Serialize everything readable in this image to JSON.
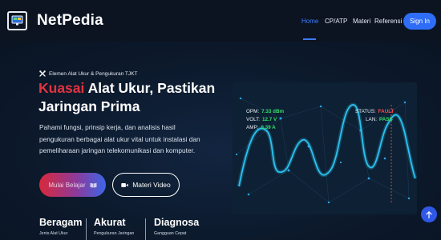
{
  "brand": {
    "name": "NetPedia",
    "icon": "monitor-icon"
  },
  "nav": {
    "items": [
      {
        "label": "Home",
        "active": true
      },
      {
        "label": "CP/ATP",
        "active": false
      },
      {
        "label": "Materi",
        "active": false
      },
      {
        "label": "Referensi",
        "active": false
      }
    ],
    "signin_label": "Sign In"
  },
  "hero": {
    "eyebrow": "Elemen Alat Ukur & Pengukuran TJKT",
    "eyebrow_icon": "tools-icon",
    "headline_accent": "Kuasai",
    "headline_rest": " Alat Ukur, Pastikan Jaringan Prima",
    "description": "Pahami fungsi, prinsip kerja, dan analisis hasil pengukuran berbagai alat ukur vital untuk instalasi dan pemeliharaan jaringan telekomunikasi dan komputer.",
    "primary_button": "Mulai Belajar",
    "primary_button_icon": "book-icon",
    "secondary_button": "Materi Video",
    "secondary_button_icon": "video-camera-icon"
  },
  "stats": [
    {
      "value": "Beragam",
      "label": "Jenis Alat Ukur"
    },
    {
      "value": "Akurat",
      "label": "Pengukuran Jaringan"
    },
    {
      "value": "Diagnosa",
      "label": "Gangguan Cepat"
    }
  ],
  "scope": {
    "readings": [
      {
        "key": "OPM:",
        "value": "7.33 dBm"
      },
      {
        "key": "VOLT:",
        "value": "12.7 V"
      },
      {
        "key": "AMP:",
        "value": "0.39 A"
      }
    ],
    "status": [
      {
        "key": "STATUS:",
        "value": "FAULT"
      },
      {
        "key": "LAN:",
        "value": "PASS"
      }
    ]
  },
  "colors": {
    "accent_red": "#e43340",
    "accent_blue": "#2f6df6",
    "reading_green": "#34e06a",
    "background": "#0b1626"
  },
  "back_to_top_icon": "arrow-up-icon"
}
